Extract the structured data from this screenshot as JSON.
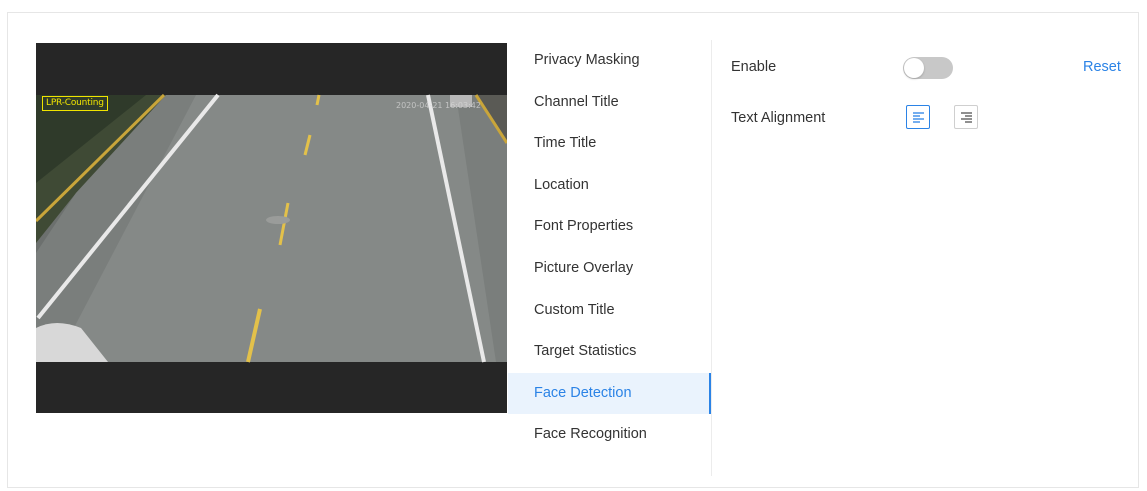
{
  "preview": {
    "osd_channel_title": "LPR-Counting",
    "osd_time": "2020-04-21 16:03:42"
  },
  "menu": {
    "items": [
      {
        "label": "Privacy Masking",
        "active": false
      },
      {
        "label": "Channel Title",
        "active": false
      },
      {
        "label": "Time Title",
        "active": false
      },
      {
        "label": "Location",
        "active": false
      },
      {
        "label": "Font Properties",
        "active": false
      },
      {
        "label": "Picture Overlay",
        "active": false
      },
      {
        "label": "Custom Title",
        "active": false
      },
      {
        "label": "Target Statistics",
        "active": false
      },
      {
        "label": "Face Detection",
        "active": true
      },
      {
        "label": "Face Recognition",
        "active": false
      }
    ]
  },
  "settings": {
    "enable_label": "Enable",
    "enable_value": false,
    "reset_label": "Reset",
    "text_alignment_label": "Text Alignment",
    "alignment_options": [
      "left-align-icon",
      "right-align-icon"
    ],
    "selected_alignment": "left-align-icon"
  },
  "colors": {
    "accent": "#2b83e6",
    "active_bg": "#eaf3fd",
    "osd_yellow": "#f0e400",
    "toggle_off": "#c8c8c8"
  }
}
